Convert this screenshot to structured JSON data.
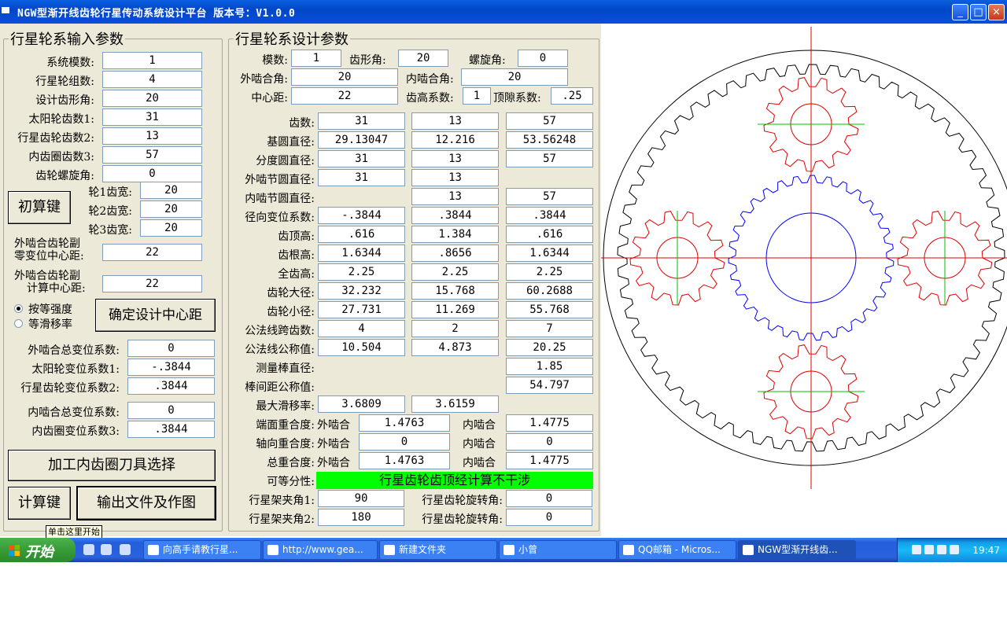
{
  "window": {
    "title": "NGW型渐开线齿轮行星传动系统设计平台   版本号：V1.0.0",
    "controls": {
      "min": "_",
      "max": "□",
      "close": "×"
    }
  },
  "input_frame": {
    "legend": "行星轮系输入参数",
    "fields": [
      {
        "label": "系统模数:",
        "value": "1"
      },
      {
        "label": "行星轮组数:",
        "value": "4"
      },
      {
        "label": "设计齿形角:",
        "value": "20"
      },
      {
        "label": "太阳轮齿数1:",
        "value": "31"
      },
      {
        "label": "行星齿轮齿数2:",
        "value": "13"
      },
      {
        "label": "内齿圈齿数3:",
        "value": "57"
      },
      {
        "label": "齿轮螺旋角:",
        "value": "0"
      }
    ],
    "widths": [
      {
        "label": "轮1齿宽:",
        "value": "20"
      },
      {
        "label": "轮2齿宽:",
        "value": "20"
      },
      {
        "label": "轮3齿宽:",
        "value": "20"
      }
    ],
    "init_button": "初算键",
    "zero_center_label_1": "外啮合齿轮副",
    "zero_center_label_2": "零变位中心距:",
    "zero_center_value": "22",
    "calc_center_label_1": "外啮合齿轮副",
    "calc_center_label_2": "计算中心距:",
    "calc_center_value": "22",
    "radio_strength": "按等强度",
    "radio_slip": "等滑移率",
    "confirm_button": "确定设计中心距",
    "shift_fields": [
      {
        "label": "外啮合总变位系数:",
        "value": "0"
      },
      {
        "label": "太阳轮变位系数1:",
        "value": "-.3844"
      },
      {
        "label": "行星齿轮变位系数2:",
        "value": ".3844"
      }
    ],
    "inner_fields": [
      {
        "label": "内啮合总变位系数:",
        "value": "0"
      },
      {
        "label": "内齿圈变位系数3:",
        "value": ".3844"
      }
    ],
    "cutter_button": "加工内齿圈刀具选择",
    "calc_button": "计算键",
    "output_button": "输出文件及作图"
  },
  "design_frame": {
    "legend": "行星轮系设计参数",
    "module_label": "模数:",
    "module_value": "1",
    "pressure_label": "齿形角:",
    "pressure_value": "20",
    "helix_label": "螺旋角:",
    "helix_value": "0",
    "ext_angle_label": "外啮合角:",
    "ext_angle_value": "20",
    "int_angle_label": "内啮合角:",
    "int_angle_value": "20",
    "center_label": "中心距:",
    "center_value": "22",
    "addendum_coef_label": "齿高系数:",
    "addendum_coef_value": "1",
    "clearance_label": "顶隙系数:",
    "clearance_value": ".25",
    "rows": [
      {
        "label": "齿数:",
        "v": [
          "31",
          "13",
          "57"
        ]
      },
      {
        "label": "基圆直径:",
        "v": [
          "29.13047",
          "12.216",
          "53.56248"
        ]
      },
      {
        "label": "分度圆直径:",
        "v": [
          "31",
          "13",
          "57"
        ]
      },
      {
        "label": "外啮节圆直径:",
        "v": [
          "31",
          "13",
          ""
        ]
      },
      {
        "label": "内啮节圆直径:",
        "v": [
          "",
          "13",
          "57"
        ]
      },
      {
        "label": "径向变位系数:",
        "v": [
          "-.3844",
          ".3844",
          ".3844"
        ]
      },
      {
        "label": "齿顶高:",
        "v": [
          ".616",
          "1.384",
          ".616"
        ]
      },
      {
        "label": "齿根高:",
        "v": [
          "1.6344",
          ".8656",
          "1.6344"
        ]
      },
      {
        "label": "全齿高:",
        "v": [
          "2.25",
          "2.25",
          "2.25"
        ]
      },
      {
        "label": "齿轮大径:",
        "v": [
          "32.232",
          "15.768",
          "60.2688"
        ]
      },
      {
        "label": "齿轮小径:",
        "v": [
          "27.731",
          "11.269",
          "55.768"
        ]
      },
      {
        "label": "公法线跨齿数:",
        "v": [
          "4",
          "2",
          "7"
        ]
      },
      {
        "label": "公法线公称值:",
        "v": [
          "10.504",
          "4.873",
          "20.25"
        ]
      },
      {
        "label": "测量棒直径:",
        "v": [
          "",
          "",
          "1.85"
        ]
      },
      {
        "label": "棒间距公称值:",
        "v": [
          "",
          "",
          "54.797"
        ]
      },
      {
        "label": "最大滑移率:",
        "v": [
          "3.6809",
          "3.6159",
          ""
        ]
      }
    ],
    "overlap": [
      {
        "label": "端面重合度:",
        "ext_label": "外啮合",
        "ext": "1.4763",
        "int_label": "内啮合",
        "int": "1.4775"
      },
      {
        "label": "轴向重合度:",
        "ext_label": "外啮合",
        "ext": "0",
        "int_label": "内啮合",
        "int": "0"
      },
      {
        "label": "总重合度:",
        "ext_label": "外啮合",
        "ext": "1.4763",
        "int_label": "内啮合",
        "int": "1.4775"
      }
    ],
    "assembly_label": "可等分性:",
    "assembly_value": "行星齿轮齿顶经计算不干涉",
    "carrier1_label": "行星架夹角1:",
    "carrier1_value": "90",
    "carrier2_label": "行星架夹角2:",
    "carrier2_value": "180",
    "rot1_label": "行星齿轮旋转角:",
    "rot1_value": "0",
    "rot2_label": "行星齿轮旋转角:",
    "rot2_value": "0"
  },
  "gear_drawing": {
    "sun_teeth": 31,
    "planet_teeth": 13,
    "ring_teeth": 57,
    "planet_count": 4,
    "colors": {
      "sun": "#0000ff",
      "planet": "#e00000",
      "ring": "#000000",
      "axis_red": "#e00000",
      "axis_green": "#00c000"
    }
  },
  "tooltip": "单击这里开始",
  "taskbar": {
    "start": "开始",
    "tasks": [
      "向高手请教行星...",
      "http://www.gea...",
      "新建文件夹",
      "小曾",
      "QQ邮箱 - Micros...",
      "NGW型渐开线齿..."
    ],
    "clock": "19:47"
  }
}
